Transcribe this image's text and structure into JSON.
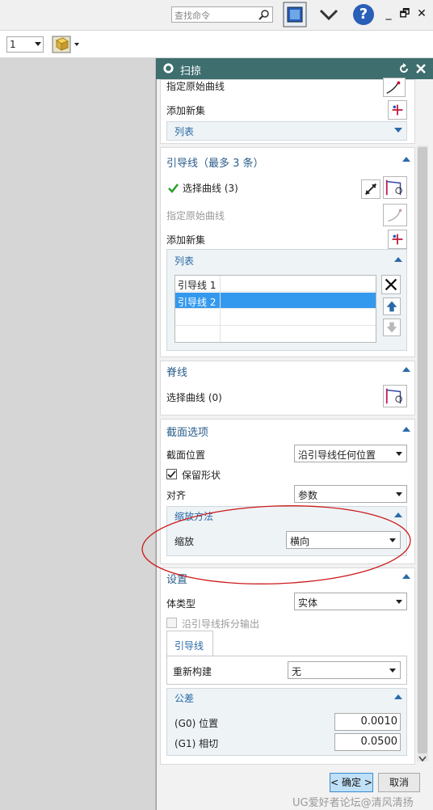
{
  "topbar": {
    "search_placeholder": "查找命令",
    "window_controls": [
      "_",
      "🗗",
      "✕"
    ]
  },
  "toolbar2": {
    "layer_value": "1"
  },
  "dialog": {
    "title": "扫掠",
    "section0": {
      "specify_original": "指定原始曲线",
      "add_new_set": "添加新集",
      "list_label": "列表"
    },
    "guides": {
      "title": "引导线（最多 3 条）",
      "select_curve": "选择曲线 (3)",
      "specify_original": "指定原始曲线",
      "add_new_set": "添加新集",
      "list_label": "列表",
      "items": [
        "引导线 1",
        "引导线 2"
      ]
    },
    "spine": {
      "title": "脊线",
      "select_curve": "选择曲线 (0)"
    },
    "section_options": {
      "title": "截面选项",
      "position_label": "截面位置",
      "position_value": "沿引导线任何位置",
      "preserve_shape": "保留形状",
      "align_label": "对齐",
      "align_value": "参数",
      "scaling_method": "缩放方法",
      "scale_label": "缩放",
      "scale_value": "横向"
    },
    "settings": {
      "title": "设置",
      "body_type_label": "体类型",
      "body_type_value": "实体",
      "split_output": "沿引导线拆分输出",
      "tab_guides": "引导线",
      "rebuild_label": "重新构建",
      "rebuild_value": "无",
      "tolerance": "公差",
      "g0_label": "(G0) 位置",
      "g0_value": "0.0010",
      "g1_label": "(G1) 相切",
      "g1_value": "0.0500"
    },
    "ok": "< 确定 >",
    "cancel": "取消"
  },
  "watermark": "UG爱好者论坛@清风清扬",
  "colors": {
    "title_bar": "#3e6e6e",
    "section_heading": "#2a5d8a",
    "selection": "#3399ee",
    "annotation": "#cc1a1a"
  }
}
